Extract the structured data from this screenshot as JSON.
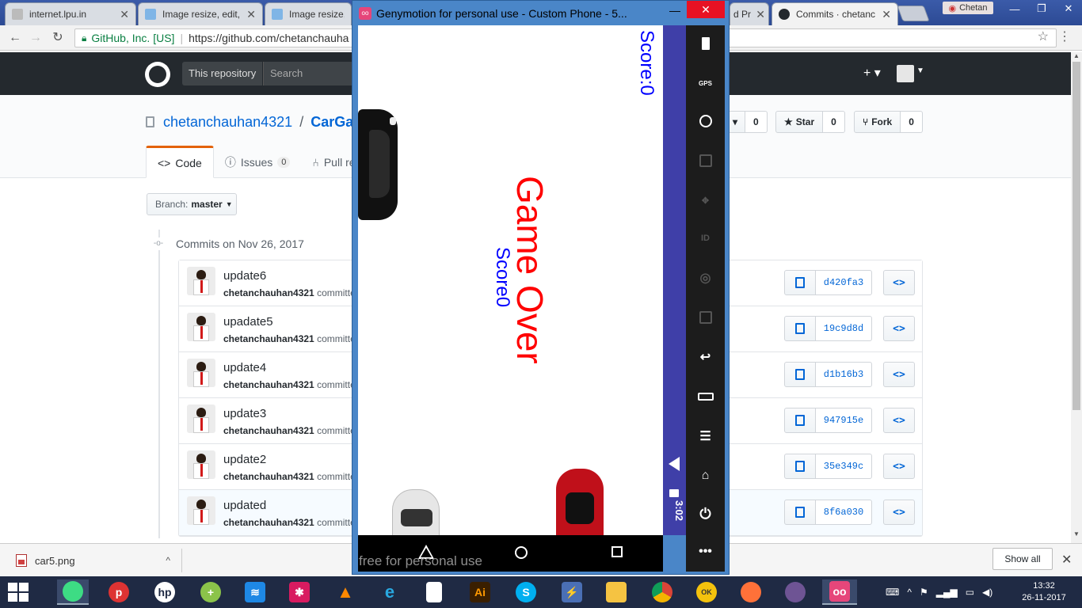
{
  "browser": {
    "tabs": [
      {
        "label": "internet.lpu.in",
        "icon": "globe-icon"
      },
      {
        "label": "Image resize, edit,",
        "icon": "page-icon"
      },
      {
        "label": "Image resize, e",
        "icon": "page-icon"
      },
      {
        "label": "d Pr",
        "icon": "page-icon"
      },
      {
        "label": "Commits · chetanc",
        "icon": "github-icon"
      }
    ],
    "profile_name": "Chetan",
    "secure_label": "GitHub, Inc. [US]",
    "url": "https://github.com/chetanchauha"
  },
  "github": {
    "scope": "This repository",
    "search_placeholder": "Search",
    "owner": "chetanchauhan4321",
    "repo": "CarGam",
    "watch_count": "0",
    "star_label": "Star",
    "star_count": "0",
    "fork_label": "Fork",
    "fork_count": "0",
    "tabs": [
      {
        "label": "Code"
      },
      {
        "label": "Issues",
        "count": "0"
      },
      {
        "label": "Pull re"
      }
    ],
    "branch_label": "Branch:",
    "branch_value": "master",
    "commits_heading": "Commits on Nov 26, 2017",
    "commits": [
      {
        "title": "update6",
        "author": "chetanchauhan4321",
        "meta": "committe",
        "sha": "d420fa3"
      },
      {
        "title": "upadate5",
        "author": "chetanchauhan4321",
        "meta": "committe",
        "sha": "19c9d8d"
      },
      {
        "title": "update4",
        "author": "chetanchauhan4321",
        "meta": "committe",
        "sha": "d1b16b3"
      },
      {
        "title": "update3",
        "author": "chetanchauhan4321",
        "meta": "committe",
        "sha": "947915e"
      },
      {
        "title": "update2",
        "author": "chetanchauhan4321",
        "meta": "committe",
        "sha": "35e349c"
      },
      {
        "title": "updated",
        "author": "chetanchauhan4321",
        "meta": "committe",
        "sha": "8f6a030"
      }
    ]
  },
  "downloads": {
    "file": "car5.png",
    "show_all": "Show all"
  },
  "genymotion": {
    "title": "Genymotion for personal use - Custom Phone - 5...",
    "watermark": "free for personal use",
    "status_time": "3:02",
    "tools": [
      "battery-icon",
      "gps-icon",
      "webcam-icon",
      "clapper-icon",
      "dpad-icon",
      "id-icon",
      "cast-icon",
      "sms-icon",
      "back-icon",
      "recent-apps-icon",
      "menu-icon",
      "home-icon",
      "power-icon",
      "more-icon"
    ],
    "gps_label": "GPS",
    "id_label": "ID"
  },
  "game": {
    "score_top": "Score:0",
    "game_over": "Game Over",
    "score_mid": "Score0"
  },
  "taskbar": {
    "time": "13:32",
    "date": "26-11-2017"
  }
}
